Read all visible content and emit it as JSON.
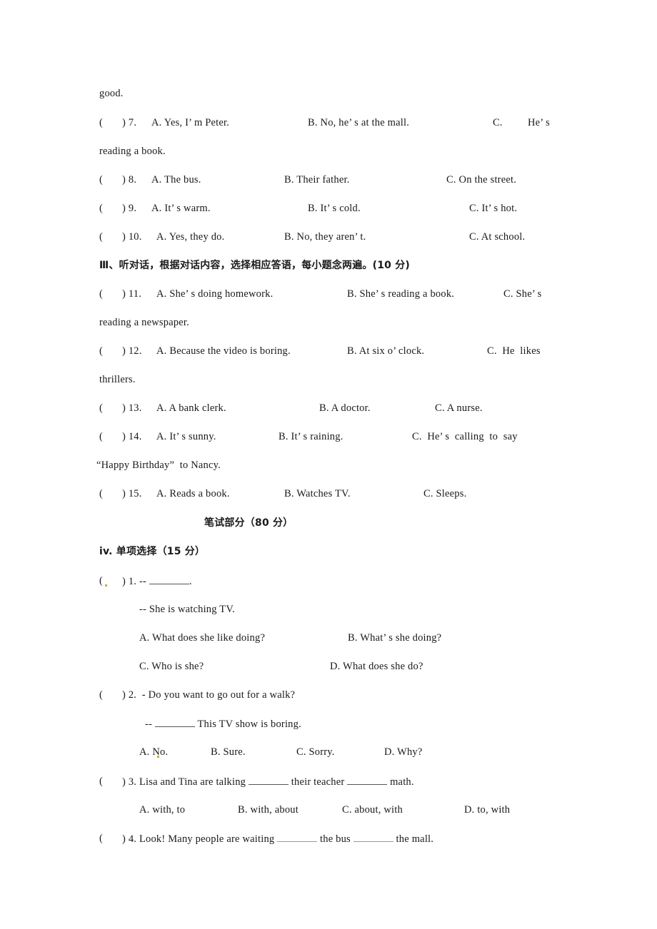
{
  "continuation": "good.",
  "listening_part2": [
    {
      "number": "7",
      "A": "A. Yes, I’ m Peter.",
      "B": "B. No, he’ s at the mall.",
      "C": "C.",
      "C_tail": "He’ s",
      "C_wrap": "reading a book."
    },
    {
      "number": "8",
      "A": "A. The bus.",
      "B": "B. Their father.",
      "C": "C. On the street."
    },
    {
      "number": "9",
      "A": "A. It’ s warm.",
      "B": "B. It’ s cold.",
      "C": "C. It’ s hot."
    },
    {
      "number": "10",
      "A": "A. Yes, they do.",
      "B": "B. No, they aren’ t.",
      "C": "C. At school."
    }
  ],
  "section3": {
    "heading": "Ⅲ、听对话，根据对话内容，选择相应答语，每小题念两遍。(10 分)",
    "questions": [
      {
        "number": "11",
        "A": "A. She’ s doing homework.",
        "B": "B. She’ s reading a book.",
        "C": "C. She’ s",
        "C_wrap": "reading a newspaper."
      },
      {
        "number": "12",
        "A": "A. Because the video is boring.",
        "B": "B. At six o’ clock.",
        "C": "C.  He  likes",
        "C_wrap": "thrillers."
      },
      {
        "number": "13",
        "A": "A. A bank clerk.",
        "B": "B. A doctor.",
        "C": "C. A nurse."
      },
      {
        "number": "14",
        "A": "A. It’ s sunny.",
        "B": "B. It’ s raining.",
        "C": "C.  He’ s  calling  to  say",
        "C_wrap": "“Happy Birthday”  to Nancy."
      },
      {
        "number": "15",
        "A": "A. Reads a book.",
        "B": "B. Watches TV.",
        "C": "C. Sleeps."
      }
    ]
  },
  "written_part": {
    "title": "笔试部分（80 分）",
    "section4_heading": "iv. 单项选择（15 分）",
    "q1": {
      "stem": ") 1. -- ",
      "stem_end": ".",
      "reply": "-- She is watching TV.",
      "A": "A. What does she like doing?",
      "B": "B. What’ s she doing?",
      "C": "C. Who is she?",
      "D": "D. What does she do?"
    },
    "q2": {
      "stem": ") 2.  - Do you want to go out for a walk?",
      "reply_prefix": "-- ",
      "reply_suffix": " This TV show is boring.",
      "A": "A. No.",
      "B": "B. Sure.",
      "C": "C. Sorry.",
      "D": "D. Why?"
    },
    "q3": {
      "stem_1": ") 3. Lisa and Tina are talking ",
      "stem_2": " their teacher ",
      "stem_3": " math.",
      "A": "A. with, to",
      "B": "B. with, about",
      "C": "C. about, with",
      "D": "D. to, with"
    },
    "q4": {
      "stem_1": ") 4. Look! Many people are waiting ",
      "stem_2": " the bus ",
      "stem_3": " the mall."
    }
  },
  "answer_paren_open": "(",
  "answer_paren_close": ")"
}
